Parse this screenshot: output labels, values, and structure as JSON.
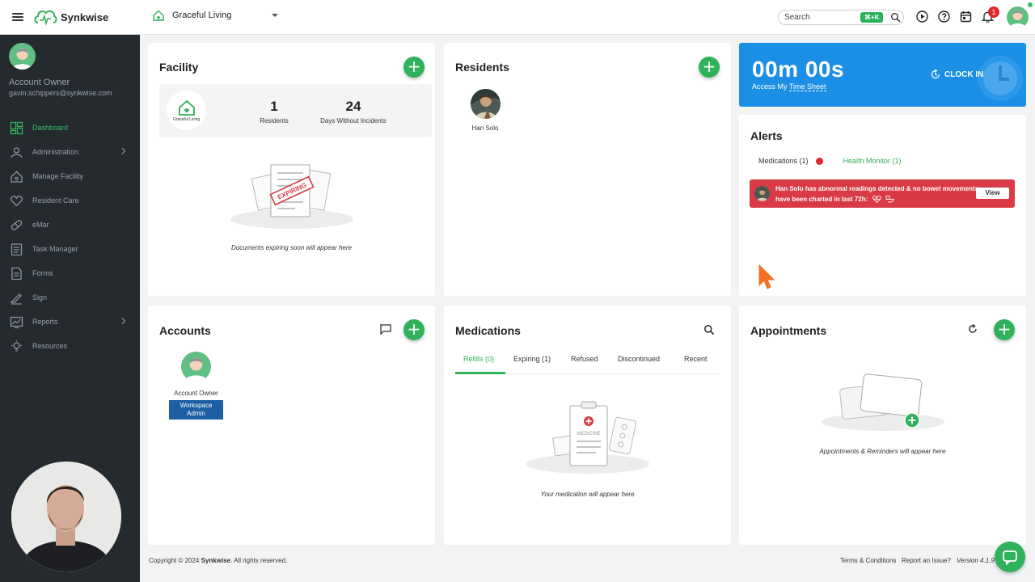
{
  "topbar": {
    "app_name": "Synkwise",
    "facility_name": "Graceful Living",
    "search_placeholder": "Search",
    "search_shortcut": "⌘+K",
    "notification_count": "1",
    "icons": [
      "menu-icon",
      "play-icon",
      "help-icon",
      "calendar-icon",
      "bell-icon"
    ]
  },
  "sidebar": {
    "user_role": "Account Owner",
    "user_email": "gavin.schippers@synkwise.com",
    "items": [
      {
        "label": "Dashboard",
        "icon": "dashboard-icon",
        "active": true
      },
      {
        "label": "Administration",
        "icon": "administration-icon",
        "has_children": true
      },
      {
        "label": "Manage Facility",
        "icon": "facility-icon"
      },
      {
        "label": "Resident Care",
        "icon": "heart-icon"
      },
      {
        "label": "eMar",
        "icon": "pill-icon"
      },
      {
        "label": "Task Manager",
        "icon": "tasks-icon"
      },
      {
        "label": "Forms",
        "icon": "forms-icon"
      },
      {
        "label": "Sign",
        "icon": "sign-icon"
      },
      {
        "label": "Reports",
        "icon": "reports-icon",
        "has_children": true
      },
      {
        "label": "Resources",
        "icon": "resources-icon"
      }
    ]
  },
  "facility": {
    "title": "Facility",
    "logo_text": "Graceful Living",
    "residents_count": "1",
    "residents_label": "Residents",
    "days_count": "24",
    "days_label": "Days Without Incidents",
    "illustration_stamp": "EXPIRING",
    "empty_text": "Documents expiring soon will appear here"
  },
  "residents": {
    "title": "Residents",
    "items": [
      {
        "name": "Han Solo"
      }
    ]
  },
  "timer": {
    "value": "00m 00s",
    "link_prefix": "Access My",
    "link_text": "Time Sheet",
    "clock_in_label": "CLOCK IN"
  },
  "alerts": {
    "title": "Alerts",
    "tab_medications": "Medications (1)",
    "tab_health": "Health Monitor (1)",
    "message": "Han Solo has abnormal readings detected & no bowel movements have been charted in last 72h:",
    "view_label": "View"
  },
  "accounts": {
    "title": "Accounts",
    "items": [
      {
        "name": "Account Owner",
        "badge": "Workspace Admin"
      }
    ]
  },
  "medications": {
    "title": "Medications",
    "tabs": [
      "Refills (0)",
      "Expiring (1)",
      "Refused",
      "Discontinued",
      "Recent"
    ],
    "active_tab": 0,
    "illustration_label": "MEDICINE",
    "empty_text": "Your medication will appear here"
  },
  "appointments": {
    "title": "Appointments",
    "empty_text": "Appointments & Reminders will appear here"
  },
  "footer": {
    "copyright_prefix": "Copyright © 2024",
    "brand": "Synkwise",
    "copyright_suffix": ". All rights reserved.",
    "terms": "Terms & Conditions",
    "report": "Report an Issue?",
    "version": "Version 4.1.9"
  },
  "colors": {
    "accent_green": "#2fb25b",
    "sidebar_bg": "#252a2f",
    "timer_blue": "#1b8fe6",
    "alert_red": "#d93a45"
  }
}
